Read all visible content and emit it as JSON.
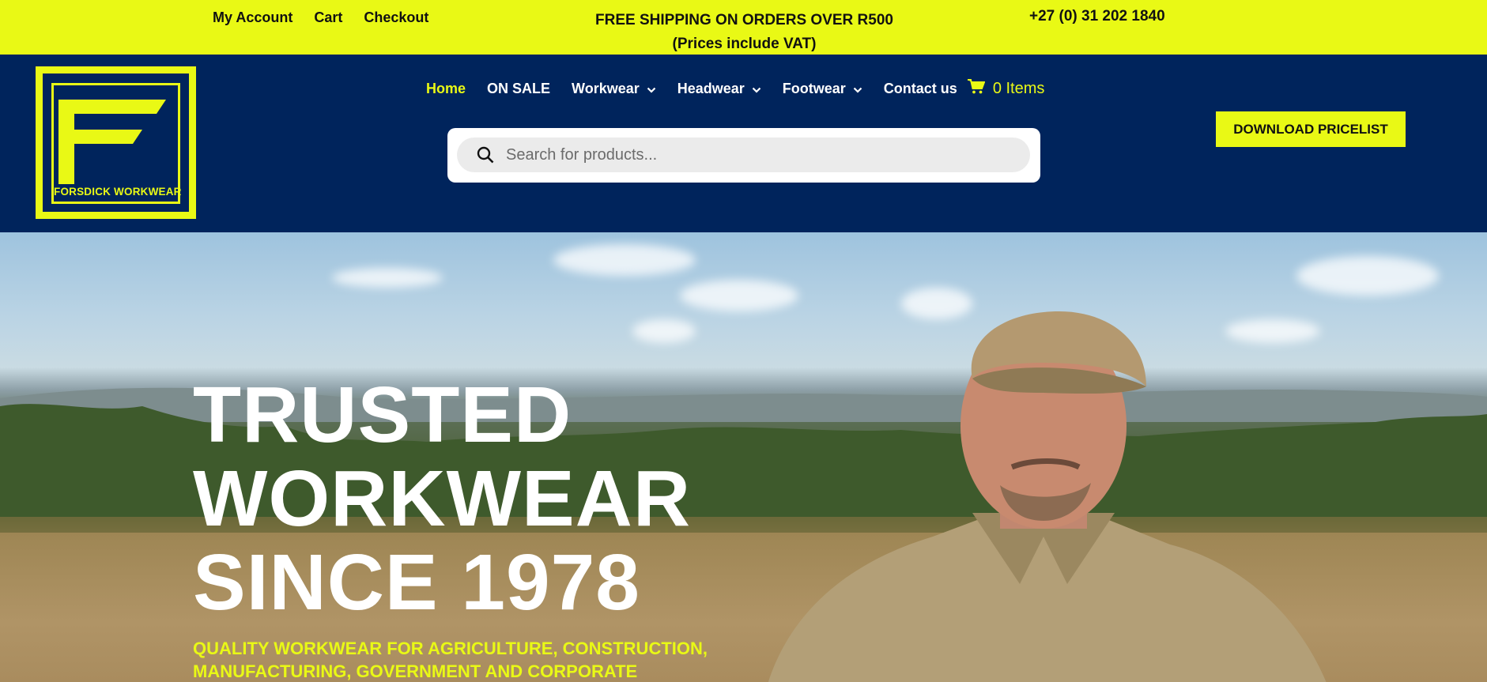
{
  "topbar": {
    "links": [
      "My Account",
      "Cart",
      "Checkout"
    ],
    "shipping_line1": "FREE SHIPPING ON ORDERS OVER R500",
    "shipping_line2": "(Prices include VAT)",
    "phone": "+27 (0) 31 202 1840"
  },
  "logo": {
    "text": "FORSDICK WORKWEAR"
  },
  "nav": {
    "items": [
      {
        "label": "Home",
        "active": true
      },
      {
        "label": "ON SALE"
      },
      {
        "label": "Workwear",
        "dropdown": true
      },
      {
        "label": "Headwear",
        "dropdown": true
      },
      {
        "label": "Footwear",
        "dropdown": true
      },
      {
        "label": "Contact us"
      }
    ],
    "cart_label": "0 Items"
  },
  "search": {
    "placeholder": "Search for products..."
  },
  "pricelist_label": "DOWNLOAD PRICELIST",
  "hero": {
    "title_lines": [
      "TRUSTED",
      "WORKWEAR",
      "SINCE 1978"
    ],
    "subtitle": "QUALITY WORKWEAR FOR AGRICULTURE, CONSTRUCTION, MANUFACTURING, GOVERNMENT AND CORPORATE"
  },
  "colors": {
    "accent": "#e9f915",
    "navy": "#00245c"
  }
}
